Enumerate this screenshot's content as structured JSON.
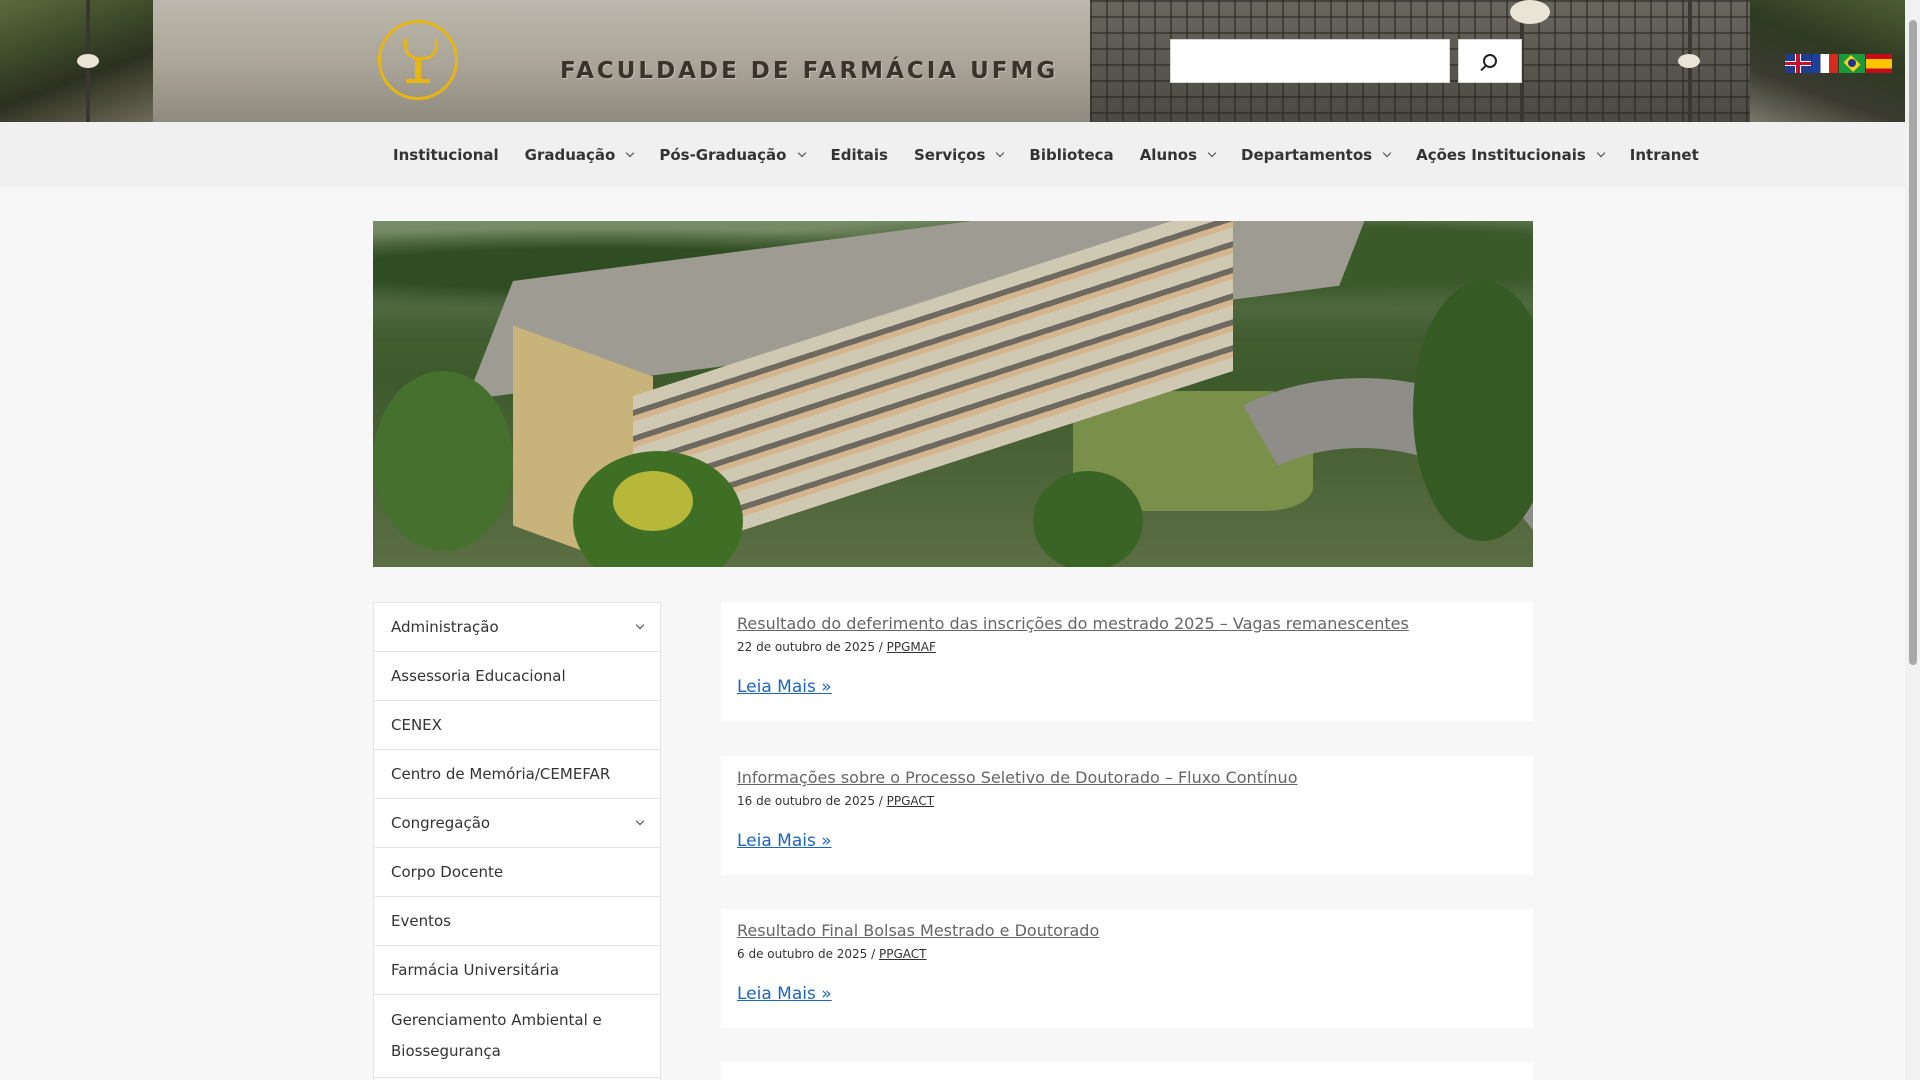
{
  "header": {
    "site_title": "FACULDADE DE FARMÁCIA UFMG",
    "search": {
      "placeholder": "",
      "value": ""
    },
    "languages": [
      {
        "name": "English",
        "icon": "flag-uk-icon"
      },
      {
        "name": "Français",
        "icon": "flag-fr-icon"
      },
      {
        "name": "Português",
        "icon": "flag-br-icon"
      },
      {
        "name": "Español",
        "icon": "flag-es-icon"
      }
    ]
  },
  "nav": {
    "items": [
      {
        "label": "Institucional",
        "dropdown": false
      },
      {
        "label": "Graduação",
        "dropdown": true
      },
      {
        "label": "Pós-Graduação",
        "dropdown": true
      },
      {
        "label": "Editais",
        "dropdown": false
      },
      {
        "label": "Serviços",
        "dropdown": true
      },
      {
        "label": "Biblioteca",
        "dropdown": false
      },
      {
        "label": "Alunos",
        "dropdown": true
      },
      {
        "label": "Departamentos",
        "dropdown": true
      },
      {
        "label": "Ações Institucionais",
        "dropdown": true
      },
      {
        "label": "Intranet",
        "dropdown": false
      }
    ]
  },
  "sidebar": {
    "items": [
      {
        "label": "Administração",
        "dropdown": true
      },
      {
        "label": "Assessoria Educacional",
        "dropdown": false
      },
      {
        "label": "CENEX",
        "dropdown": false
      },
      {
        "label": "Centro de Memória/CEMEFAR",
        "dropdown": false
      },
      {
        "label": "Congregação",
        "dropdown": true
      },
      {
        "label": "Corpo Docente",
        "dropdown": false
      },
      {
        "label": "Eventos",
        "dropdown": false
      },
      {
        "label": "Farmácia Universitária",
        "dropdown": false
      },
      {
        "label": "Gerenciamento Ambiental e Biossegurança",
        "dropdown": false
      }
    ]
  },
  "posts": [
    {
      "title": "Resultado do deferimento das inscrições do mestrado 2025 – Vagas remanescentes",
      "date": "22 de outubro de 2025",
      "separator": " / ",
      "author": "PPGMAF",
      "read_more": "Leia Mais »"
    },
    {
      "title": "Informações sobre o Processo Seletivo de Doutorado – Fluxo Contínuo",
      "date": "16 de outubro de 2025",
      "separator": " / ",
      "author": "PPGACT",
      "read_more": "Leia Mais »"
    },
    {
      "title": "Resultado Final Bolsas Mestrado e Doutorado",
      "date": "6 de outubro de 2025",
      "separator": " / ",
      "author": "PPGACT",
      "read_more": "Leia Mais »"
    }
  ],
  "colors": {
    "accent_gold": "#e8b613",
    "link_blue": "#1a64c6",
    "nav_bg": "#f0f0f0",
    "page_bg": "#f7f7f7"
  }
}
